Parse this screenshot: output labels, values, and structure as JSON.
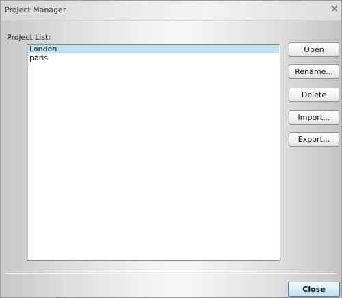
{
  "window": {
    "title": "Project Manager",
    "close_glyph": "✕"
  },
  "project_list": {
    "label": "Project List:",
    "items": [
      {
        "name": "London",
        "selected": true
      },
      {
        "name": "paris",
        "selected": false
      }
    ]
  },
  "buttons": {
    "open": "Open",
    "rename": "Rename...",
    "delete": "Delete",
    "import": "Import...",
    "export": "Export..."
  },
  "footer": {
    "close": "Close"
  },
  "colors": {
    "selection": "#bfe3f3",
    "default_button_border": "#4f7ea6"
  }
}
